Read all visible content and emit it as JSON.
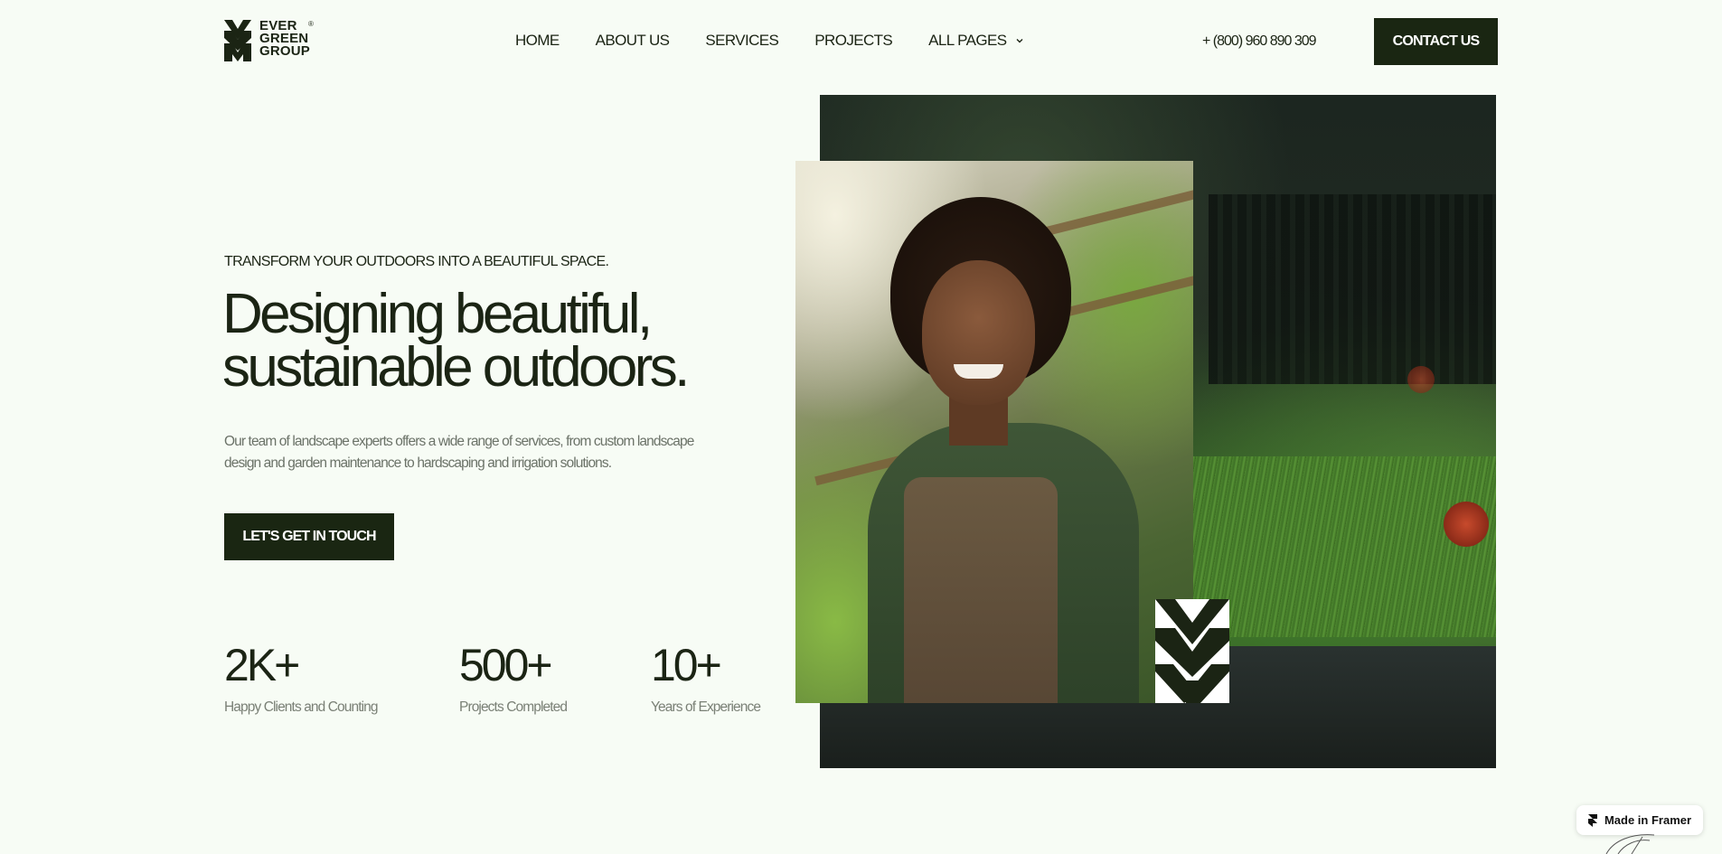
{
  "logo": {
    "line1": "EVER",
    "line2": "GREEN",
    "line3": "GROUP",
    "registered": "®",
    "icon": "leaf-chevron-logo"
  },
  "nav": {
    "items": [
      {
        "label": "HOME"
      },
      {
        "label": "ABOUT US"
      },
      {
        "label": "SERVICES"
      },
      {
        "label": "PROJECTS"
      },
      {
        "label": "ALL PAGES",
        "icon": "chevron-down-icon"
      }
    ]
  },
  "header": {
    "phone": "+ (800) 960 890 309",
    "contact_label": "CONTACT US"
  },
  "hero": {
    "eyebrow": "TRANSFORM YOUR OUTDOORS INTO A BEAUTIFUL SPACE.",
    "headline_line1": "Designing beautiful,",
    "headline_line2": "sustainable outdoors.",
    "description": "Our team of landscape experts offers a wide range of services, from custom landscape design and garden maintenance to hardscaping and irrigation solutions.",
    "cta_label": "LET'S GET IN TOUCH"
  },
  "stats": [
    {
      "value": "2K+",
      "label": "Happy Clients and Counting"
    },
    {
      "value": "500+",
      "label": "Projects Completed"
    },
    {
      "value": "10+",
      "label": "Years of Experience"
    }
  ],
  "badge": {
    "label": "Made in Framer",
    "icon": "framer-icon"
  },
  "colors": {
    "background": "#f7fcf5",
    "primary_dark": "#1a2612",
    "text": "#1b2414",
    "muted_text": "#6b7268"
  }
}
